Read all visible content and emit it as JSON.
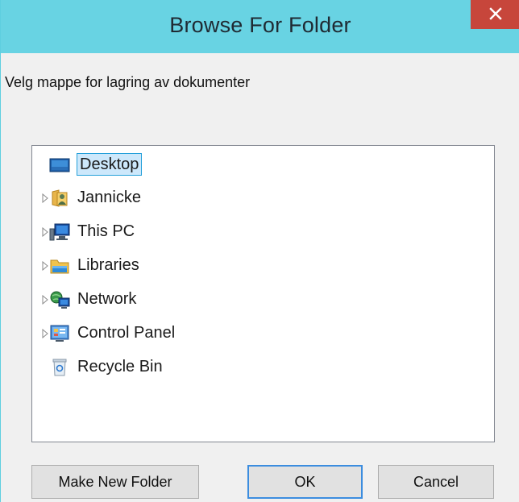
{
  "window": {
    "title": "Browse For Folder",
    "close_symbol": "✕"
  },
  "prompt": "Velg mappe for lagring av dokumenter",
  "tree": {
    "items": [
      {
        "label": "Desktop",
        "icon": "desktop-icon",
        "expandable": false,
        "selected": true
      },
      {
        "label": "Jannicke",
        "icon": "user-folder-icon",
        "expandable": true,
        "selected": false
      },
      {
        "label": "This PC",
        "icon": "computer-icon",
        "expandable": true,
        "selected": false
      },
      {
        "label": "Libraries",
        "icon": "libraries-icon",
        "expandable": true,
        "selected": false
      },
      {
        "label": "Network",
        "icon": "network-icon",
        "expandable": true,
        "selected": false
      },
      {
        "label": "Control Panel",
        "icon": "control-panel-icon",
        "expandable": true,
        "selected": false
      },
      {
        "label": "Recycle Bin",
        "icon": "recycle-bin-icon",
        "expandable": false,
        "selected": false
      }
    ]
  },
  "buttons": {
    "make_new_folder": "Make New Folder",
    "ok": "OK",
    "cancel": "Cancel"
  },
  "colors": {
    "titlebar": "#68d3e3",
    "close_button": "#c7463b",
    "selection": "#cde8fb",
    "selection_border": "#26a0da",
    "default_button_border": "#3c8ddf"
  }
}
